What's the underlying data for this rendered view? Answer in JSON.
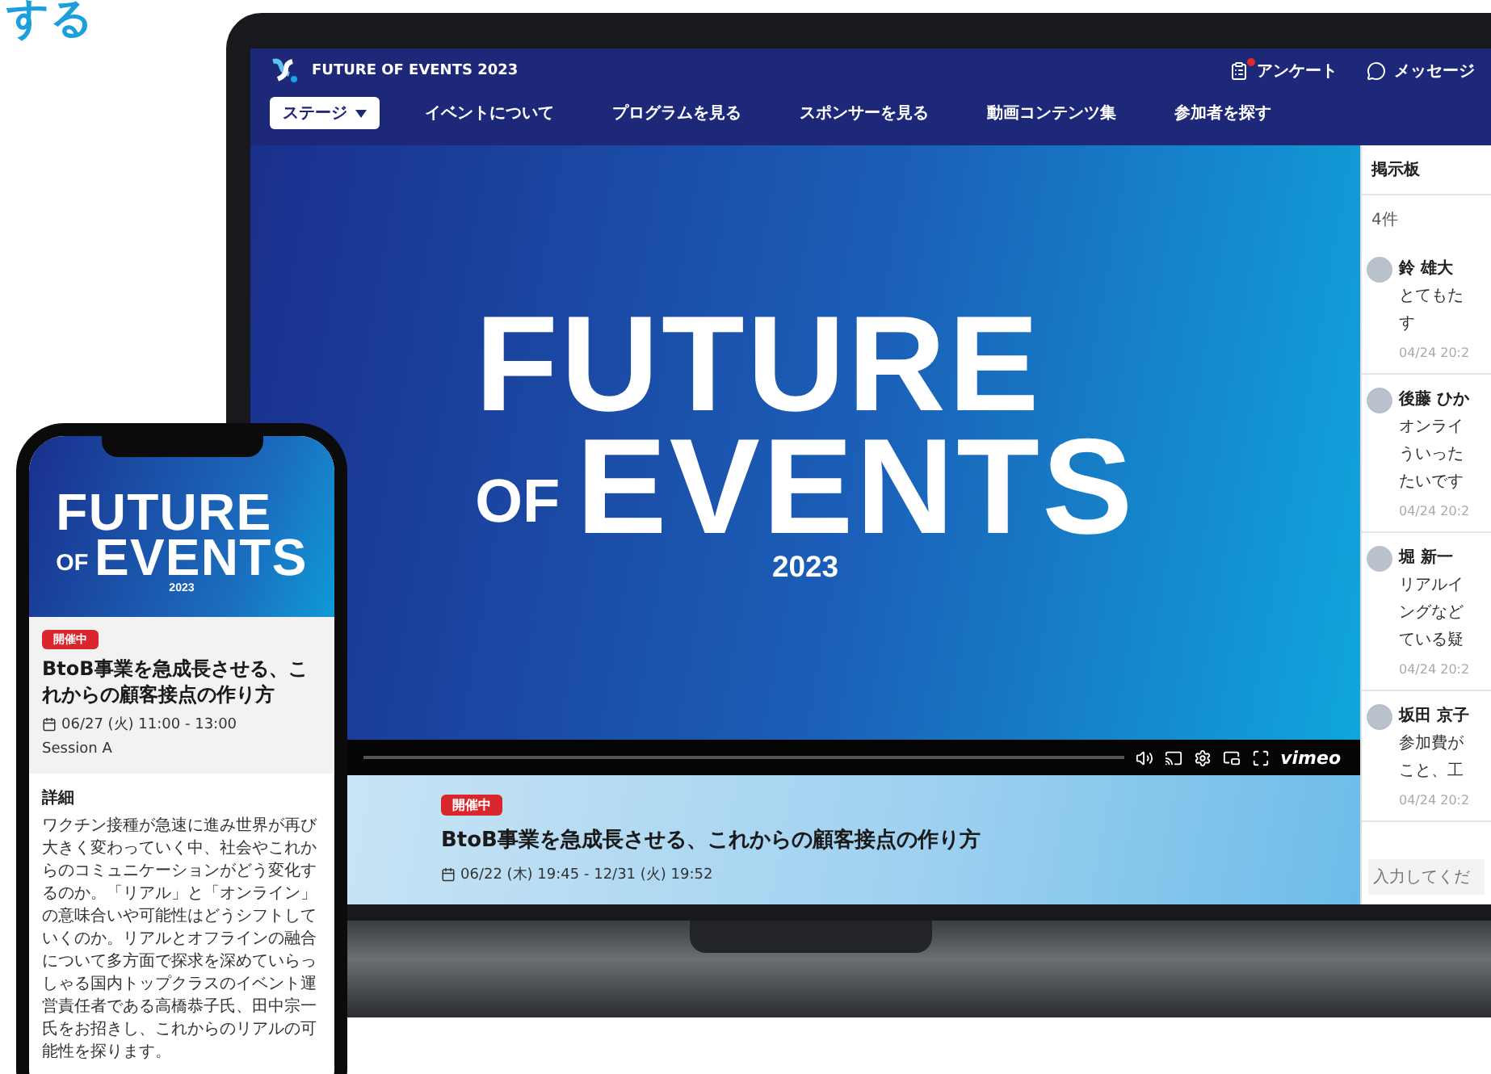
{
  "heading": "する",
  "laptop": {
    "brand": "FUTURE OF EVENTS 2023",
    "header_actions": [
      {
        "kind": "survey",
        "label": "アンケート",
        "badge": true
      },
      {
        "kind": "message",
        "label": "メッセージ",
        "badge": false
      }
    ],
    "nav": [
      {
        "label": "ステージ",
        "selected": true,
        "dropdown": true
      },
      {
        "label": "イベントについて",
        "selected": false,
        "dropdown": false
      },
      {
        "label": "プログラムを見る",
        "selected": false,
        "dropdown": false
      },
      {
        "label": "スポンサーを見る",
        "selected": false,
        "dropdown": false
      },
      {
        "label": "動画コンテンツ集",
        "selected": false,
        "dropdown": false
      },
      {
        "label": "参加者を探す",
        "selected": false,
        "dropdown": false
      }
    ],
    "hero": {
      "line_1": "FUTURE",
      "small": "OF",
      "line_2": "EVENTS",
      "year": "2023"
    },
    "player": {
      "brand": "vimeo"
    },
    "session": {
      "status": "開催中",
      "title": "BtoB事業を急成長させる、これからの顧客接点の作り方",
      "date": "06/22 (木) 19:45 - 12/31 (火) 19:52"
    },
    "board": {
      "title": "掲示板",
      "count": "4件",
      "placeholder": "入力してくだ",
      "comments": [
        {
          "name": "鈴 雄大",
          "lines": [
            "とてもた",
            "す"
          ],
          "time": "04/24 20:2"
        },
        {
          "name": "後藤 ひか",
          "lines": [
            "オンライ",
            "ういった",
            "たいです"
          ],
          "time": "04/24 20:2"
        },
        {
          "name": "堀 新一",
          "lines": [
            "リアルイ",
            "ングなど",
            "ている疑"
          ],
          "time": "04/24 20:2"
        },
        {
          "name": "坂田 京子",
          "lines": [
            "参加費が",
            "こと、工"
          ],
          "time": "04/24 20:2"
        }
      ]
    }
  },
  "phone": {
    "hero": {
      "line_1": "FUTURE",
      "small": "OF",
      "line_2": "EVENTS",
      "year": "2023"
    },
    "status": "開催中",
    "title": "BtoB事業を急成長させる、これからの顧客接点の作り方",
    "date": "06/27 (火) 11:00 - 13:00",
    "session": "Session A",
    "details_title": "詳細",
    "details": "ワクチン接種が急速に進み世界が再び大きく変わっていく中、社会やこれからのコミュニケーションがどう変化するのか。「リアル」と「オンライン」の意味合いや可能性はどうシフトしていくのか。リアルとオフラインの融合について多方面で探求を深めていらっしゃる国内トップクラスのイベント運営責任者である高橋恭子氏、田中宗一氏をお招きし、これからのリアルの可能性を探ります。"
  }
}
